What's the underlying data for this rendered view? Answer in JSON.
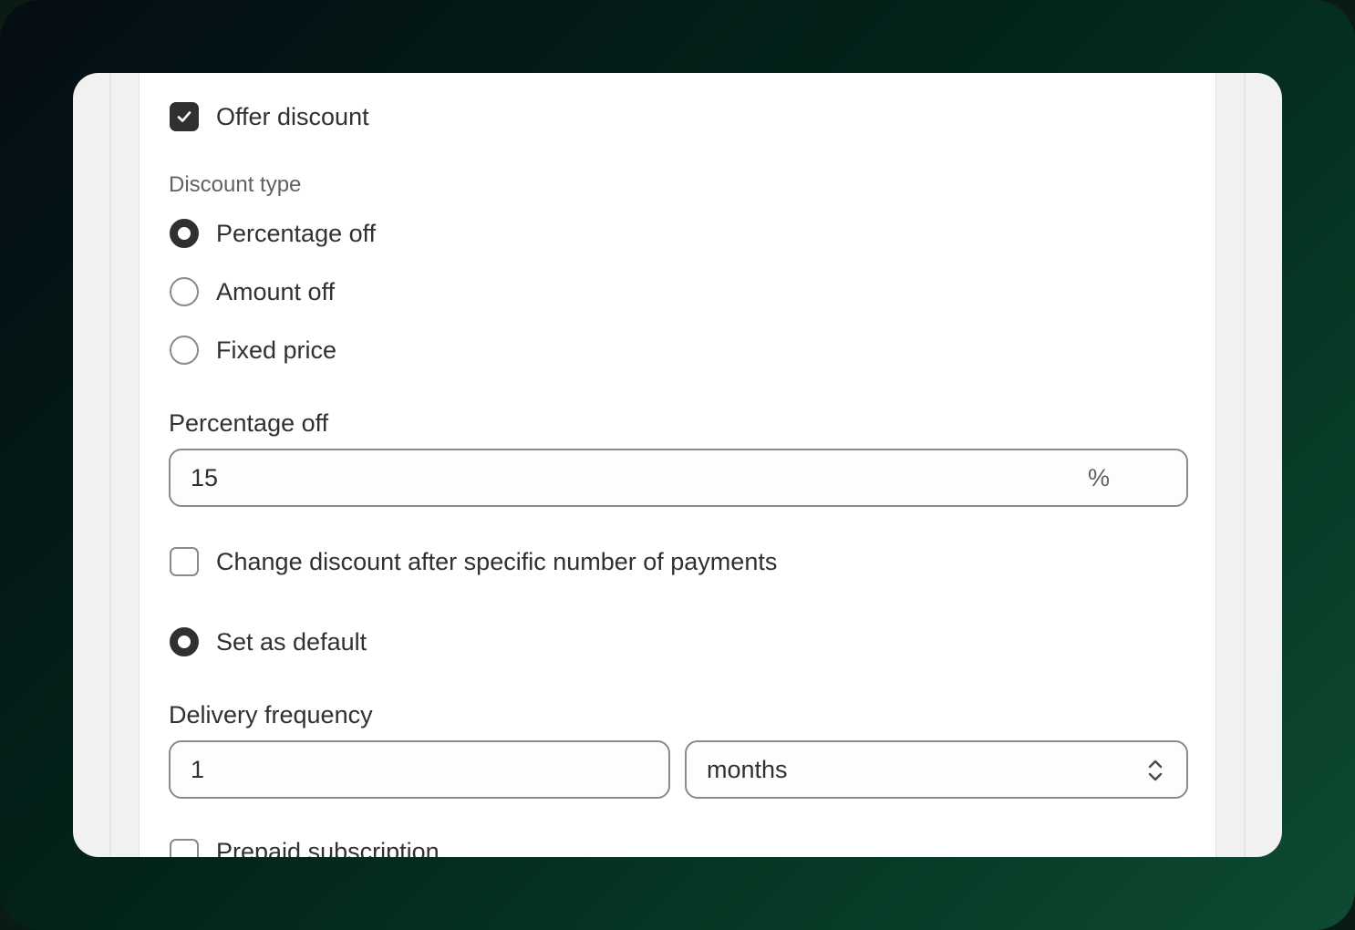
{
  "offer_discount": {
    "label": "Offer discount",
    "checked": true
  },
  "discount_type": {
    "label": "Discount type",
    "options": [
      {
        "label": "Percentage off",
        "selected": true
      },
      {
        "label": "Amount off",
        "selected": false
      },
      {
        "label": "Fixed price",
        "selected": false
      }
    ]
  },
  "percentage_field": {
    "label": "Percentage off",
    "value": "15",
    "suffix": "%"
  },
  "change_discount": {
    "label": "Change discount after specific number of payments",
    "checked": false
  },
  "set_default": {
    "label": "Set as default",
    "selected": true
  },
  "delivery_frequency": {
    "label": "Delivery frequency",
    "interval_value": "1",
    "unit_value": "months"
  },
  "prepaid": {
    "label": "Prepaid subscription",
    "checked": false
  },
  "icons": {
    "check": "checkmark-icon",
    "select_arrows": "chevron-up-down-icon"
  }
}
